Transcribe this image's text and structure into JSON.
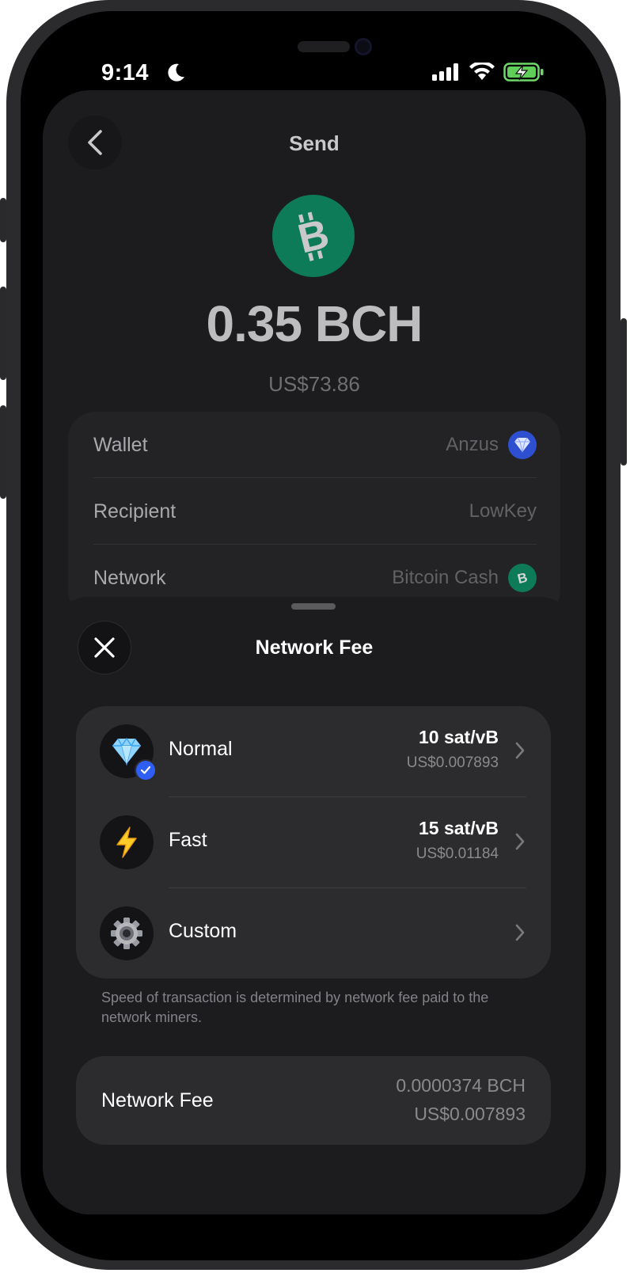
{
  "status_bar": {
    "time": "9:14",
    "icons": [
      "moon-icon",
      "cellular-signal-icon",
      "wifi-icon",
      "battery-charging-icon"
    ]
  },
  "header": {
    "title": "Send",
    "back_icon": "chevron-left-icon"
  },
  "asset": {
    "icon": "bitcoin-cash-logo",
    "amount": "0.35 BCH",
    "amount_usd": "US$73.86",
    "brand_color": "#0d7a58"
  },
  "details": [
    {
      "label": "Wallet",
      "value": "Anzus",
      "icon": "diamond-icon"
    },
    {
      "label": "Recipient",
      "value": "LowKey"
    },
    {
      "label": "Network",
      "value": "Bitcoin Cash",
      "icon": "bitcoin-cash-logo"
    }
  ],
  "sheet": {
    "title": "Network Fee",
    "close_icon": "close-icon",
    "options": [
      {
        "name": "Normal",
        "icon": "gem-emoji-icon",
        "rate": "10 sat/vB",
        "usd": "US$0.007893",
        "selected": true
      },
      {
        "name": "Fast",
        "icon": "lightning-emoji-icon",
        "rate": "15 sat/vB",
        "usd": "US$0.01184",
        "selected": false
      },
      {
        "name": "Custom",
        "icon": "gear-emoji-icon",
        "rate": "",
        "usd": "",
        "selected": false
      }
    ],
    "hint": "Speed of transaction is determined by network fee paid to the network miners.",
    "summary": {
      "label": "Network Fee",
      "bch": "0.0000374 BCH",
      "usd": "US$0.007893"
    },
    "accent_color": "#2f5ef3"
  }
}
